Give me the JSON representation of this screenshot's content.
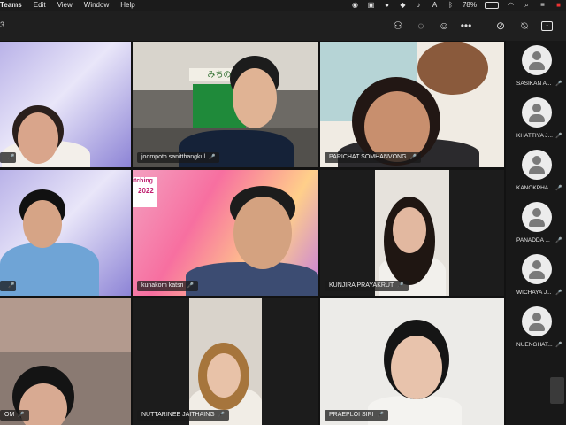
{
  "menubar": {
    "app": "Teams",
    "items": [
      "Edit",
      "View",
      "Window",
      "Help"
    ],
    "battery": "78%"
  },
  "toolbar": {
    "count": "3"
  },
  "tiles": [
    {
      "name": ""
    },
    {
      "name": "joompoth sanitthangkul"
    },
    {
      "name": "PARICHAT SOMHANVONG"
    },
    {
      "name": ""
    },
    {
      "name": "kunakorn katsri",
      "banner": "itching",
      "banner_year": "2022"
    },
    {
      "name": "KUNJIRA PRAYAKRUT"
    },
    {
      "name": "OM"
    },
    {
      "name": "NUTTARINEE JAITHAING"
    },
    {
      "name": "PRAEPLOI SIRI"
    }
  ],
  "storefront_sign": "みちの",
  "sidebar": [
    {
      "name": "SASIKAN A..."
    },
    {
      "name": "KHATTIYA J..."
    },
    {
      "name": "KANOKPHA..."
    },
    {
      "name": "PANADDA ..."
    },
    {
      "name": "WICHAYA J..."
    },
    {
      "name": "NUENGHAT..."
    }
  ],
  "colors": {
    "background": "#121212",
    "label_bg": "#191919"
  }
}
